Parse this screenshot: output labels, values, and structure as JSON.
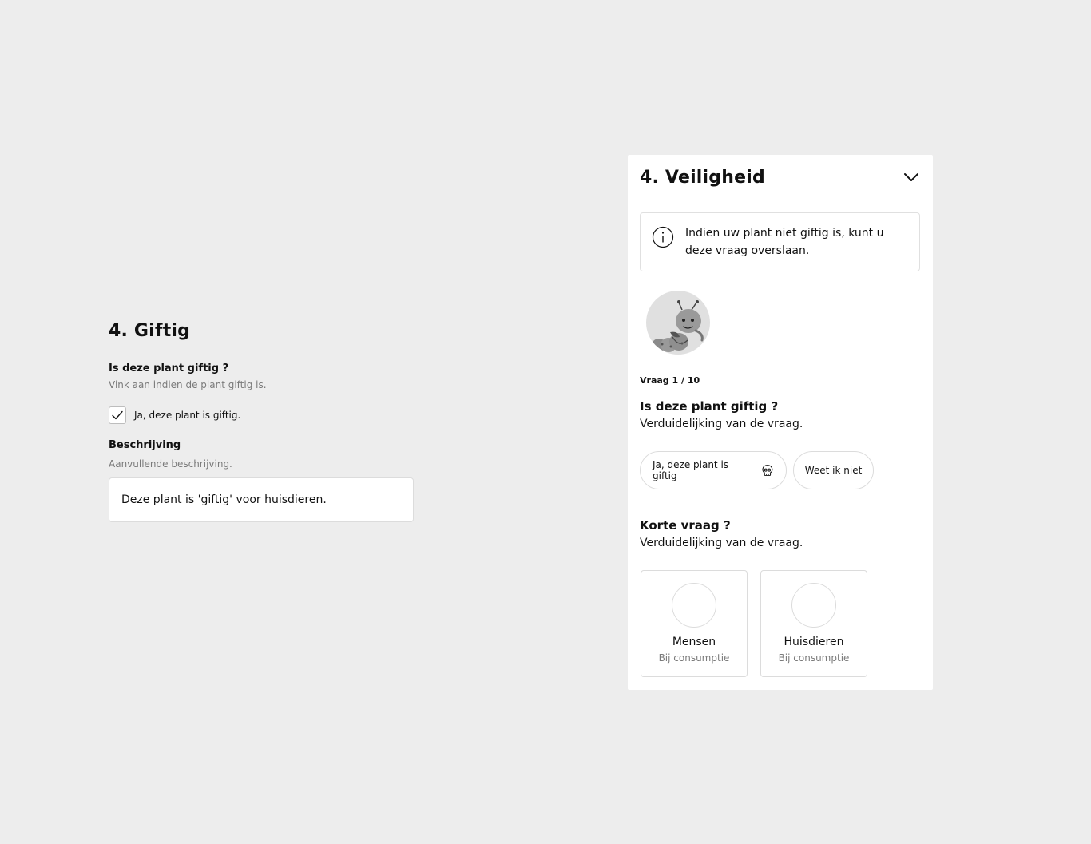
{
  "left_form": {
    "title": "4. Giftig",
    "question": "Is deze plant giftig ?",
    "question_hint": "Vink aan indien de plant giftig is.",
    "checkbox_label": "Ja, deze plant is giftig.",
    "checkbox_checked": true,
    "description_title": "Beschrijving",
    "description_hint": "Aanvullende beschrijving.",
    "description_value": "Deze plant is 'giftig' voor huisdieren."
  },
  "panel": {
    "title": "4. Veiligheid",
    "info_text": "Indien uw plant niet giftig is, kunt u deze vraag overslaan.",
    "counter": "Vraag 1 / 10",
    "question1": {
      "title": "Is deze plant giftig ?",
      "subtitle": "Verduidelijking van de vraag.",
      "option_yes": "Ja, deze plant is giftig",
      "option_unknown": "Weet ik niet"
    },
    "question2": {
      "title": "Korte vraag ?",
      "subtitle": "Verduidelijking van de vraag.",
      "cards": [
        {
          "title": "Mensen",
          "subtitle": "Bij consumptie"
        },
        {
          "title": "Huisdieren",
          "subtitle": "Bij consumptie"
        }
      ]
    }
  },
  "icons": {
    "info": "info-icon",
    "chevron": "chevron-down-icon",
    "check": "check-icon",
    "skull": "skull-icon",
    "mascot": "caterpillar-mascot"
  },
  "colors": {
    "background": "#ededed",
    "panel": "#ffffff",
    "border": "#dcdcdc",
    "muted_text": "#7a7a7a"
  }
}
